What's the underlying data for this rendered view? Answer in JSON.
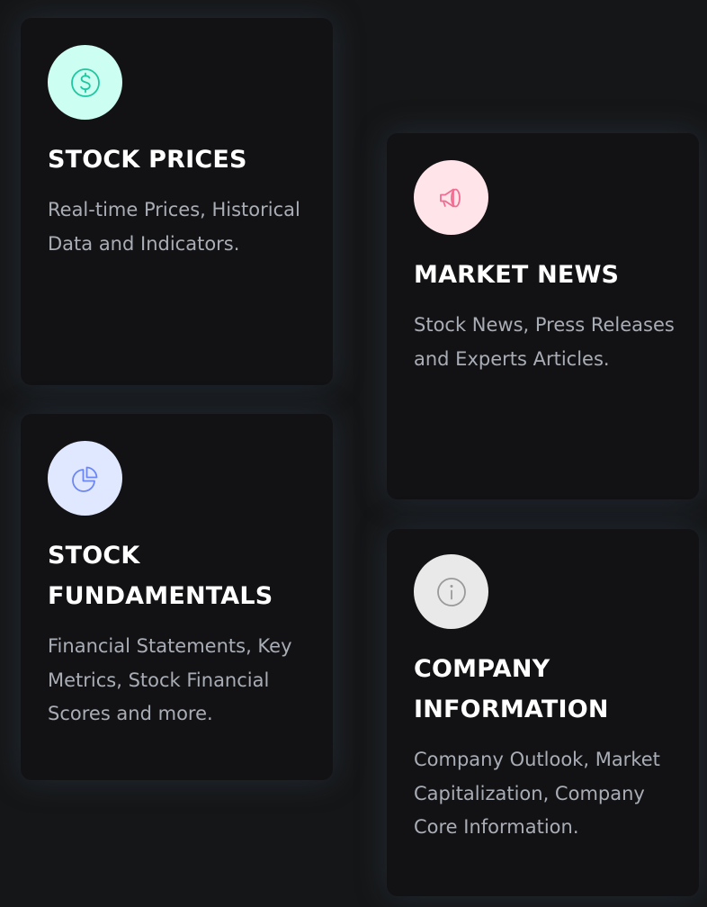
{
  "cards": [
    {
      "title": "STOCK PRICES",
      "description": "Real-time Prices, Historical Data and Indicators.",
      "icon": "dollar-icon",
      "icon_bg": "#ccfff1",
      "icon_color": "#1fc7a0"
    },
    {
      "title": "MARKET NEWS",
      "description": "Stock News, Press Releases and Experts Articles.",
      "icon": "megaphone-icon",
      "icon_bg": "#ffe4ea",
      "icon_color": "#f06d92"
    },
    {
      "title": "STOCK FUNDAMENTALS",
      "description": "Financial Statements, Key Metrics, Stock Financial Scores and more.",
      "icon": "pie-chart-icon",
      "icon_bg": "#e0e8ff",
      "icon_color": "#6d86f5"
    },
    {
      "title": "COMPANY INFORMATION",
      "description": "Company Outlook, Market Capitalization, Company Core Information.",
      "icon": "info-icon",
      "icon_bg": "#e9e9e9",
      "icon_color": "#9a9a9a"
    }
  ],
  "colors": {
    "page_background": "#151617",
    "card_background": "#121214",
    "title_text": "#ffffff",
    "description_text": "#a9adb6"
  }
}
